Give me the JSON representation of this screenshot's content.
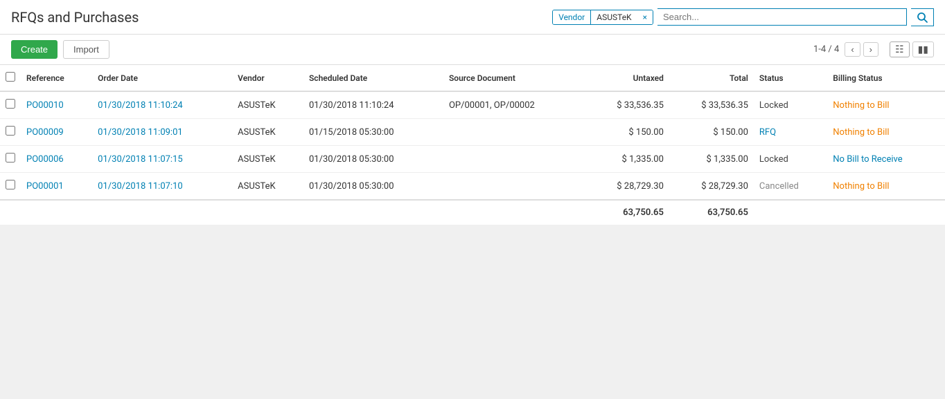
{
  "header": {
    "title": "RFQs and Purchases"
  },
  "filter": {
    "vendor_label": "Vendor",
    "vendor_value": "ASUSTeK",
    "remove_icon": "×",
    "search_placeholder": "Search..."
  },
  "actions": {
    "create_label": "Create",
    "import_label": "Import"
  },
  "pagination": {
    "range": "1-4 / 4",
    "prev_icon": "‹",
    "next_icon": "›",
    "list_icon": "≡",
    "chart_icon": "▦"
  },
  "table": {
    "columns": [
      {
        "key": "reference",
        "label": "Reference"
      },
      {
        "key": "order_date",
        "label": "Order Date"
      },
      {
        "key": "vendor",
        "label": "Vendor"
      },
      {
        "key": "scheduled_date",
        "label": "Scheduled Date"
      },
      {
        "key": "source_document",
        "label": "Source Document"
      },
      {
        "key": "untaxed",
        "label": "Untaxed",
        "align": "right"
      },
      {
        "key": "total",
        "label": "Total",
        "align": "right"
      },
      {
        "key": "status",
        "label": "Status"
      },
      {
        "key": "billing_status",
        "label": "Billing Status"
      }
    ],
    "rows": [
      {
        "reference": "PO00010",
        "order_date": "01/30/2018 11:10:24",
        "vendor": "ASUSTeK",
        "scheduled_date": "01/30/2018 11:10:24",
        "source_document": "OP/00001, OP/00002",
        "untaxed": "$ 33,536.35",
        "total": "$ 33,536.35",
        "status": "Locked",
        "status_type": "locked",
        "billing_status": "Nothing to Bill",
        "billing_type": "nothing"
      },
      {
        "reference": "PO00009",
        "order_date": "01/30/2018 11:09:01",
        "vendor": "ASUSTeK",
        "scheduled_date": "01/15/2018 05:30:00",
        "source_document": "",
        "untaxed": "$ 150.00",
        "total": "$ 150.00",
        "status": "RFQ",
        "status_type": "rfq",
        "billing_status": "Nothing to Bill",
        "billing_type": "nothing"
      },
      {
        "reference": "PO00006",
        "order_date": "01/30/2018 11:07:15",
        "vendor": "ASUSTeK",
        "scheduled_date": "01/30/2018 05:30:00",
        "source_document": "",
        "untaxed": "$ 1,335.00",
        "total": "$ 1,335.00",
        "status": "Locked",
        "status_type": "locked",
        "billing_status": "No Bill to Receive",
        "billing_type": "nobill"
      },
      {
        "reference": "PO00001",
        "order_date": "01/30/2018 11:07:10",
        "vendor": "ASUSTeK",
        "scheduled_date": "01/30/2018 05:30:00",
        "source_document": "",
        "untaxed": "$ 28,729.30",
        "total": "$ 28,729.30",
        "status": "Cancelled",
        "status_type": "cancelled",
        "billing_status": "Nothing to Bill",
        "billing_type": "nothing"
      }
    ],
    "totals": {
      "untaxed": "63,750.65",
      "total": "63,750.65"
    }
  }
}
